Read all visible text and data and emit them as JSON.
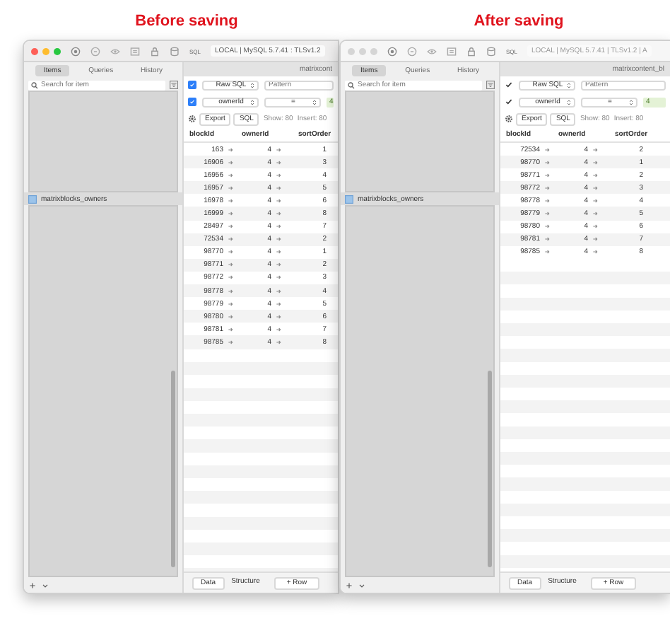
{
  "windows": [
    {
      "caption": "Before saving",
      "active": true,
      "sql_badge": "SQL",
      "connection": "LOCAL | MySQL 5.7.41 : TLSv1.2",
      "sidebar_tabs": [
        {
          "label": "Items",
          "selected": true
        },
        {
          "label": "Queries",
          "selected": false
        },
        {
          "label": "History",
          "selected": false
        }
      ],
      "search": {
        "placeholder": "Search for item"
      },
      "items": [
        {
          "label": "matrixblocks_owners",
          "selected": true
        }
      ],
      "table_title": "matrixcont",
      "filters": [
        {
          "checked": true,
          "column": "Raw SQL",
          "placeholder": "Pattern"
        },
        {
          "checked": true,
          "column": "ownerId",
          "operator": "=",
          "value": "4"
        }
      ],
      "actions": [
        "Export",
        "SQL"
      ],
      "show": "Show: 80",
      "insert": "Insert: 80",
      "columns": [
        "blockId",
        "ownerId",
        "sortOrder"
      ],
      "rows": [
        [
          "163",
          "4",
          "1"
        ],
        [
          "16906",
          "4",
          "3"
        ],
        [
          "16956",
          "4",
          "4"
        ],
        [
          "16957",
          "4",
          "5"
        ],
        [
          "16978",
          "4",
          "6"
        ],
        [
          "16999",
          "4",
          "8"
        ],
        [
          "28497",
          "4",
          "7"
        ],
        [
          "72534",
          "4",
          "2"
        ],
        [
          "98770",
          "4",
          "1"
        ],
        [
          "98771",
          "4",
          "2"
        ],
        [
          "98772",
          "4",
          "3"
        ],
        [
          "98778",
          "4",
          "4"
        ],
        [
          "98779",
          "4",
          "5"
        ],
        [
          "98780",
          "4",
          "6"
        ],
        [
          "98781",
          "4",
          "7"
        ],
        [
          "98785",
          "4",
          "8"
        ]
      ],
      "footer_tabs": [
        {
          "label": "Data",
          "selected": true
        },
        {
          "label": "Structure",
          "selected": false
        }
      ],
      "add_row": "+ Row"
    },
    {
      "caption": "After saving",
      "active": false,
      "sql_badge": "SQL",
      "connection": "LOCAL | MySQL 5.7.41 | TLSv1.2 | A",
      "sidebar_tabs": [
        {
          "label": "Items",
          "selected": true
        },
        {
          "label": "Queries",
          "selected": false
        },
        {
          "label": "History",
          "selected": false
        }
      ],
      "search": {
        "placeholder": "Search for item"
      },
      "items": [
        {
          "label": "matrixblocks_owners",
          "selected": true
        }
      ],
      "table_title": "matrixcontent_bl",
      "filters": [
        {
          "checked": true,
          "column": "Raw SQL",
          "placeholder": "Pattern"
        },
        {
          "checked": true,
          "column": "ownerId",
          "operator": "=",
          "value": "4"
        }
      ],
      "actions": [
        "Export",
        "SQL"
      ],
      "show": "Show: 80",
      "insert": "Insert: 80",
      "columns": [
        "blockId",
        "ownerId",
        "sortOrder"
      ],
      "rows": [
        [
          "72534",
          "4",
          "2"
        ],
        [
          "98770",
          "4",
          "1"
        ],
        [
          "98771",
          "4",
          "2"
        ],
        [
          "98772",
          "4",
          "3"
        ],
        [
          "98778",
          "4",
          "4"
        ],
        [
          "98779",
          "4",
          "5"
        ],
        [
          "98780",
          "4",
          "6"
        ],
        [
          "98781",
          "4",
          "7"
        ],
        [
          "98785",
          "4",
          "8"
        ]
      ],
      "footer_tabs": [
        {
          "label": "Data",
          "selected": true
        },
        {
          "label": "Structure",
          "selected": false
        }
      ],
      "add_row": "+ Row"
    }
  ]
}
